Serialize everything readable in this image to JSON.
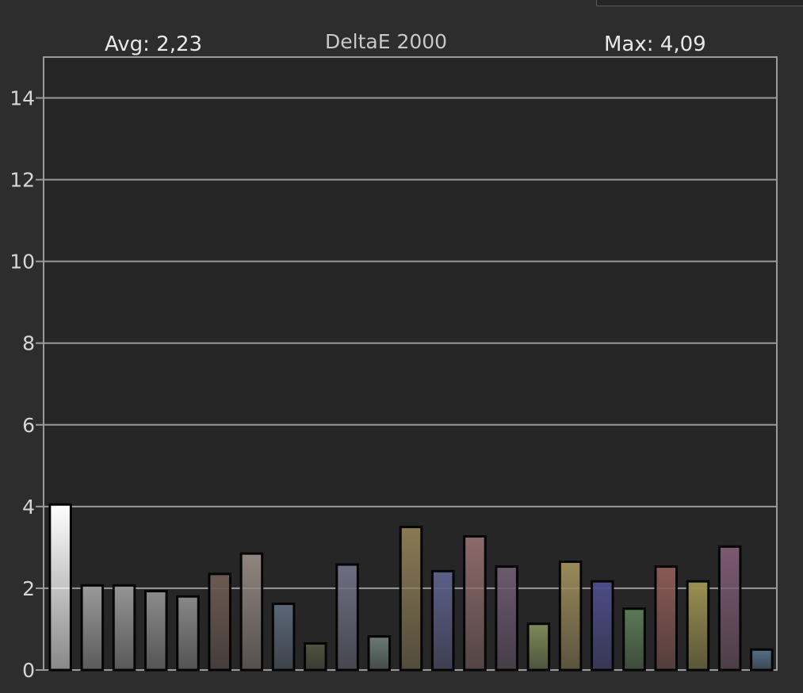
{
  "header": {
    "avg_label": "Avg: 2,23",
    "title": "DeltaE 2000",
    "max_label": "Max: 4,09"
  },
  "chart_data": {
    "type": "bar",
    "title": "DeltaE 2000",
    "xlabel": "",
    "ylabel": "",
    "ylim": [
      0,
      15
    ],
    "yticks": [
      0,
      2,
      4,
      6,
      8,
      10,
      12,
      14
    ],
    "ytick_labels": [
      "0",
      "2",
      "4",
      "6",
      "8",
      "10",
      "12",
      "14"
    ],
    "grid": true,
    "values": [
      4.05,
      2.07,
      2.07,
      1.93,
      1.8,
      2.35,
      2.85,
      1.62,
      0.65,
      2.58,
      0.82,
      3.5,
      2.42,
      3.27,
      2.53,
      1.13,
      2.65,
      2.17,
      1.5,
      2.53,
      2.17,
      3.02,
      0.5
    ],
    "colors": [
      "#ffffff",
      "#9a9a9a",
      "#959595",
      "#8c8c8c",
      "#888888",
      "#6b5a52",
      "#8f8580",
      "#5a6677",
      "#505440",
      "#6e6e82",
      "#6a7a74",
      "#8a7a55",
      "#5c5e88",
      "#8c6a6a",
      "#6a5a6e",
      "#7f8a5a",
      "#9a8a5a",
      "#4c4c88",
      "#5a7a55",
      "#8a5a55",
      "#9a9050",
      "#7c5a72",
      "#557088"
    ]
  }
}
